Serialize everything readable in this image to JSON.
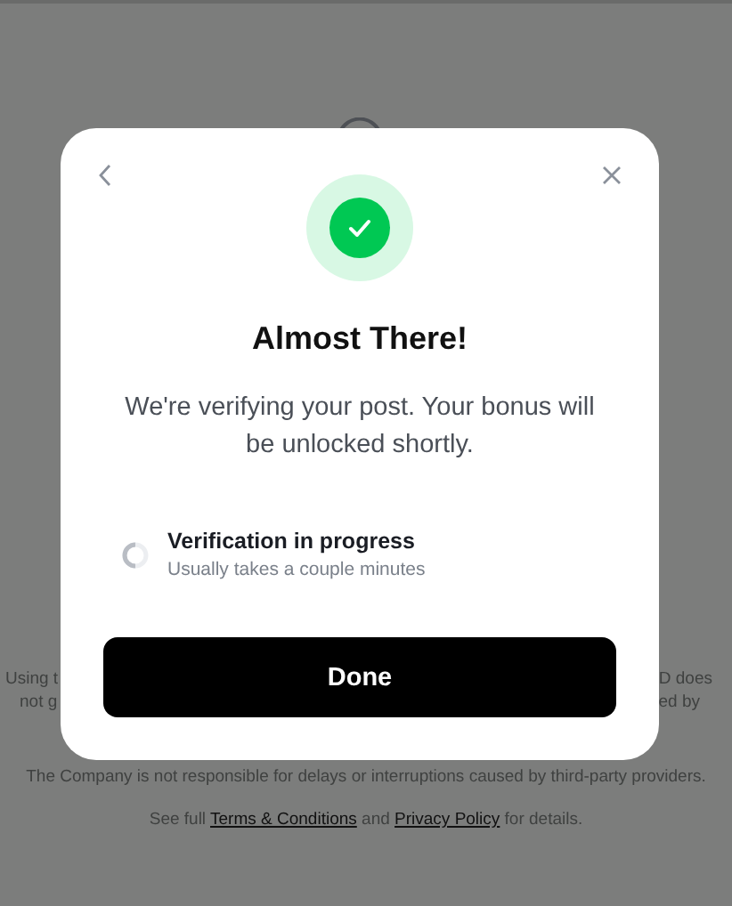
{
  "background": {
    "disclaimer_fragments": [
      {
        "left": "Using t",
        "right": "D does"
      },
      {
        "left": "not g",
        "right": "ed by"
      }
    ],
    "notice": "The Company is not responsible for delays or interruptions caused by third-party providers.",
    "links_line": {
      "prefix": "See full",
      "link_1": "Terms & Conditions",
      "middle": "and",
      "link_2": "Privacy Policy",
      "suffix": "for details."
    }
  },
  "dialog": {
    "title": "Almost There!",
    "message": "We're verifying your post. Your bonus will be unlocked shortly.",
    "status": {
      "title": "Verification in progress",
      "subtitle": "Usually takes a couple minutes"
    },
    "button": "Done"
  }
}
